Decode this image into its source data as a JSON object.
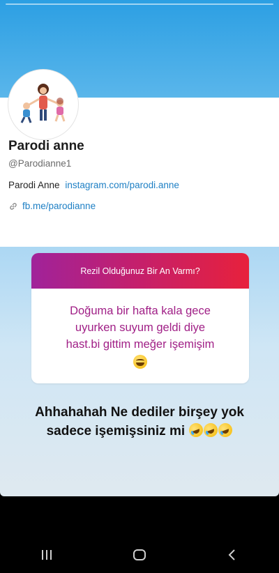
{
  "profile": {
    "name": "Parodi anne",
    "handle": "@Parodianne1",
    "bio_text": "Parodi Anne",
    "bio_link": "instagram.com/parodi.anne",
    "website": "fb.me/parodianne"
  },
  "question": {
    "prompt": "Rezil Olduğunuz Bir An Varmı?",
    "answer_line1": "Doğuma bir hafta kala gece",
    "answer_line2": "uyurken suyum geldi diye",
    "answer_line3": "hast.bi gittim meğer işemişim",
    "emoji": "grinning-squinting-face"
  },
  "caption": {
    "line1": "Ahhahahah Ne dediler birşey yok",
    "line2": "sadece işemişsiniz mi",
    "emoji": "rolling-on-floor-laughing"
  },
  "navbar": {
    "recents": "recent-apps-icon",
    "home": "home-icon",
    "back": "back-icon"
  },
  "colors": {
    "link": "#1d7fc4",
    "answer_text": "#a01f86",
    "gradient_start": "#a0239a",
    "gradient_end": "#e7213c",
    "sky_top": "#2c9fe3"
  }
}
